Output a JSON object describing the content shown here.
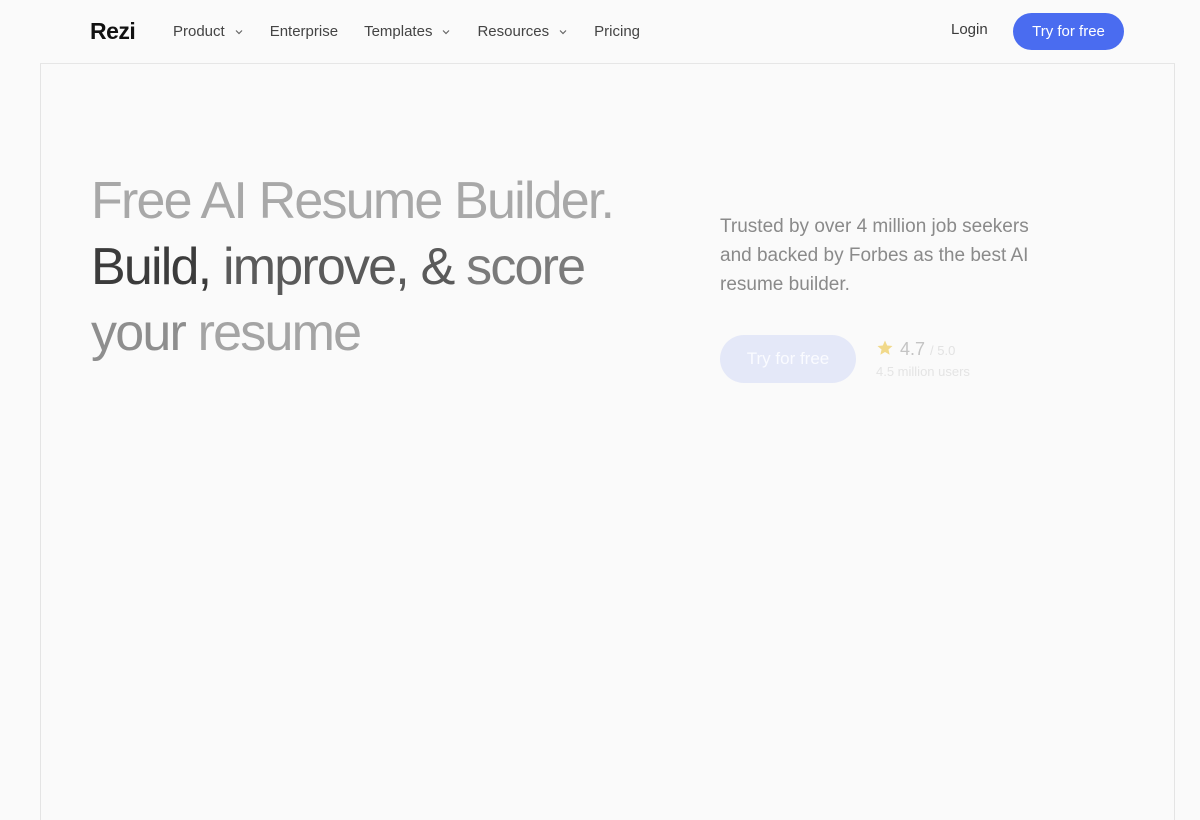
{
  "brand": {
    "logo": "Rezi"
  },
  "nav": {
    "items": [
      {
        "label": "Product",
        "dropdown": true
      },
      {
        "label": "Enterprise",
        "dropdown": false
      },
      {
        "label": "Templates",
        "dropdown": true
      },
      {
        "label": "Resources",
        "dropdown": true
      },
      {
        "label": "Pricing",
        "dropdown": false
      }
    ],
    "login": "Login",
    "cta": "Try for free"
  },
  "hero": {
    "line1": "Free AI Resume Builder.",
    "line2_a": "Build,",
    "line2_b": "improve, &",
    "line2_c": "score",
    "line3_a": "your",
    "line3_b": "resume",
    "subtitle": "Trusted by over 4 million job seekers and backed by Forbes as the best AI resume builder.",
    "cta": "Try for free",
    "rating": {
      "score": "4.7",
      "out_of": "/ 5.0",
      "users": "4.5 million users"
    }
  },
  "colors": {
    "accent": "#4a6cf0",
    "star": "#f1d98a"
  },
  "icons": {
    "dropdown": "chevron-down-icon",
    "rating": "star-icon"
  }
}
